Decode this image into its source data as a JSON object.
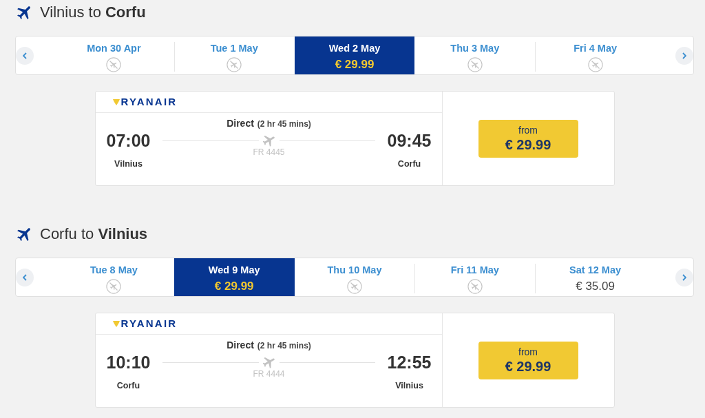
{
  "journeys": [
    {
      "title": "Vilnius to **Corfu**",
      "dates": [
        {
          "label": "Mon 30 Apr",
          "kind": "no_flights",
          "selected": false
        },
        {
          "label": "Tue 1 May",
          "kind": "no_flights",
          "selected": false
        },
        {
          "label": "Wed 2 May",
          "kind": "fare",
          "price": "€ 29.99",
          "selected": true
        },
        {
          "label": "Thu 3 May",
          "kind": "no_flights",
          "selected": false
        },
        {
          "label": "Fri 4 May",
          "kind": "no_flights",
          "selected": false
        }
      ],
      "flight": {
        "airline": "RYANAIR",
        "stops": "Direct",
        "duration": "(2 hr 45 mins)",
        "departure": {
          "time": "07:00",
          "city": "Vilnius"
        },
        "flight_number": "FR 4445",
        "arrival": {
          "time": "09:45",
          "city": "Corfu"
        },
        "fare": {
          "label": "from",
          "price": "€ 29.99"
        }
      }
    },
    {
      "title": "Corfu to **Vilnius**",
      "dates": [
        {
          "label": "Tue 8 May",
          "kind": "no_flights",
          "selected": false
        },
        {
          "label": "Wed 9 May",
          "kind": "fare",
          "price": "€ 29.99",
          "selected": true
        },
        {
          "label": "Thu 10 May",
          "kind": "no_flights",
          "selected": false
        },
        {
          "label": "Fri 11 May",
          "kind": "no_flights",
          "selected": false
        },
        {
          "label": "Sat 12 May",
          "kind": "fare",
          "price": "€ 35.09",
          "selected": false
        }
      ],
      "flight": {
        "airline": "RYANAIR",
        "stops": "Direct",
        "duration": "(2 hr 45 mins)",
        "departure": {
          "time": "10:10",
          "city": "Corfu"
        },
        "flight_number": "FR 4444",
        "arrival": {
          "time": "12:55",
          "city": "Vilnius"
        },
        "fare": {
          "label": "from",
          "price": "€ 29.99"
        }
      }
    }
  ]
}
